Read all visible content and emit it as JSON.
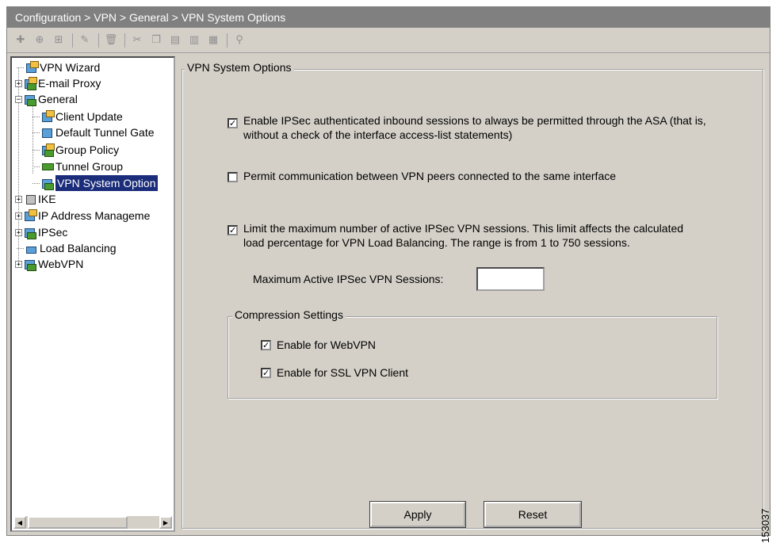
{
  "breadcrumb": "Configuration > VPN > General > VPN System Options",
  "toolbar": {
    "icons": [
      "add-icon",
      "add-child-icon",
      "add-sibling-icon",
      "edit-icon",
      "delete-icon",
      "cut-icon",
      "copy-icon",
      "paste-icon",
      "paste-after-icon",
      "paste-before-icon",
      "find-icon"
    ]
  },
  "tree": {
    "items": [
      {
        "label": "VPN Wizard"
      },
      {
        "label": "E-mail Proxy"
      },
      {
        "label": "General"
      },
      {
        "label": "Client Update"
      },
      {
        "label": "Default Tunnel Gate"
      },
      {
        "label": "Group Policy"
      },
      {
        "label": "Tunnel Group"
      },
      {
        "label": "VPN System Option"
      },
      {
        "label": "IKE"
      },
      {
        "label": "IP Address Manageme"
      },
      {
        "label": "IPSec"
      },
      {
        "label": "Load Balancing"
      },
      {
        "label": "WebVPN"
      }
    ]
  },
  "panel": {
    "title": "VPN System Options",
    "opt1": {
      "checked": true,
      "line1": "Enable IPSec authenticated inbound sessions to always be permitted through the ASA (that is,",
      "line2": "without a check of the interface access-list statements)"
    },
    "opt2": {
      "checked": false,
      "line1": "Permit communication between VPN peers connected to the same interface"
    },
    "opt3": {
      "checked": true,
      "line1": "Limit the maximum number of active IPSec VPN sessions. This limit affects the calculated",
      "line2": "load percentage for VPN Load Balancing. The range is from 1 to 750 sessions."
    },
    "max_sessions_label": "Maximum Active IPSec VPN Sessions:",
    "max_sessions_value": "",
    "compression": {
      "title": "Compression Settings",
      "webvpn": {
        "checked": true,
        "label": "Enable for WebVPN"
      },
      "sslclient": {
        "checked": true,
        "label": "Enable for SSL VPN Client"
      }
    }
  },
  "buttons": {
    "apply": "Apply",
    "reset": "Reset"
  },
  "figure_code": "153037"
}
